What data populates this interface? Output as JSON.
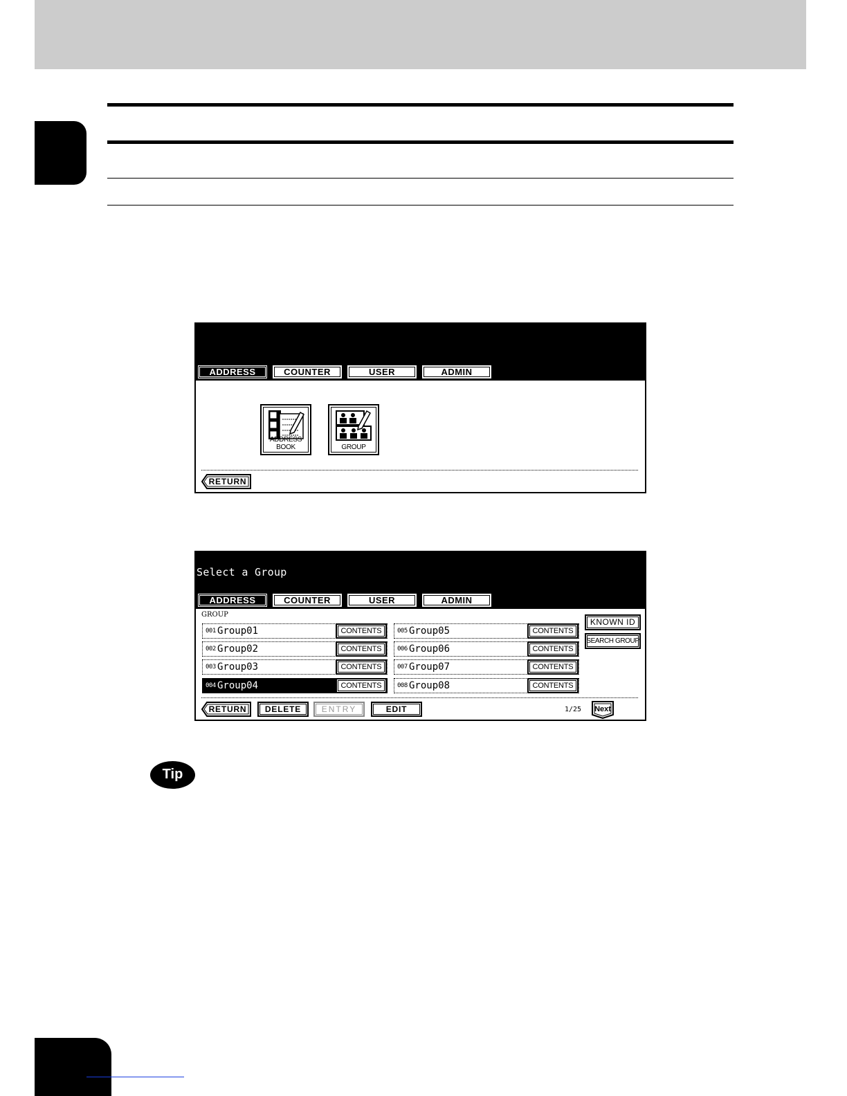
{
  "tabs": [
    "ADDRESS",
    "COUNTER",
    "USER",
    "ADMIN"
  ],
  "screen1": {
    "icons": [
      {
        "label": "ADDRESS BOOK",
        "icon": "address-book-icon"
      },
      {
        "label": "GROUP",
        "icon": "group-icon"
      }
    ],
    "return_label": "RETURN"
  },
  "screen2": {
    "title": "Select a Group",
    "section_label": "GROUP",
    "groups": [
      {
        "num": "001",
        "name": "Group01"
      },
      {
        "num": "002",
        "name": "Group02"
      },
      {
        "num": "003",
        "name": "Group03"
      },
      {
        "num": "004",
        "name": "Group04"
      },
      {
        "num": "005",
        "name": "Group05"
      },
      {
        "num": "006",
        "name": "Group06"
      },
      {
        "num": "007",
        "name": "Group07"
      },
      {
        "num": "008",
        "name": "Group08"
      }
    ],
    "contents_label": "CONTENTS",
    "known_id_label": "KNOWN ID",
    "search_group_label": "SEARCH GROUP",
    "return_label": "RETURN",
    "delete_label": "DELETE",
    "entry_label": "ENTRY",
    "edit_label": "EDIT",
    "page_indicator": "1/25",
    "next_label": "Next"
  },
  "tip_label": "Tip"
}
